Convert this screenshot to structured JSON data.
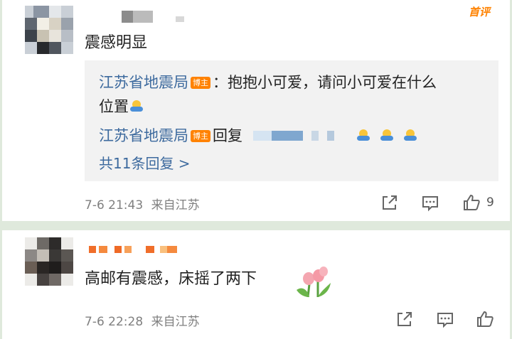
{
  "app": {
    "accent_color": "#ff8200",
    "link_color": "#3d6a9e"
  },
  "header_badge": "首评",
  "comments": [
    {
      "text": "震感明显",
      "replies": [
        {
          "author": "江苏省地震局",
          "badge": "博主",
          "text_line1": "：抱抱小可爱，请问小可爱在什么",
          "text_line2": "位置"
        },
        {
          "author": "江苏省地震局",
          "badge": "博主",
          "action": "回复"
        }
      ],
      "more_replies": "共11条回复 >",
      "time": "7-6 21:43",
      "source": "来自江苏",
      "like_count": "9"
    },
    {
      "text": "高邮有震感，床摇了两下",
      "time": "7-6 22:28",
      "source": "来自江苏"
    }
  ],
  "icons": [
    "share-icon",
    "comment-icon",
    "like-icon",
    "hug-emoji",
    "tulip-emoji"
  ]
}
